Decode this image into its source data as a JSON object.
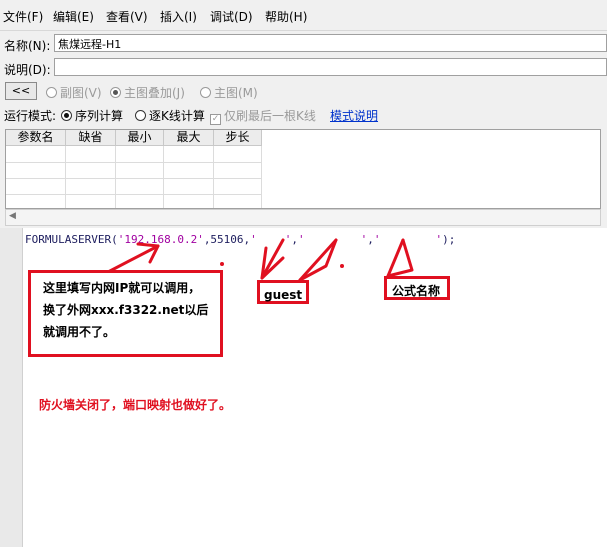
{
  "menu": [
    {
      "label": "文件(F)"
    },
    {
      "label": "编辑(E)"
    },
    {
      "label": "查看(V)"
    },
    {
      "label": "插入(I)"
    },
    {
      "label": "调试(D)"
    },
    {
      "label": "帮助(H)"
    }
  ],
  "form": {
    "name_label": "名称(N):",
    "name_value": "焦煤远程-H1",
    "desc_label": "说明(D):",
    "desc_value": "",
    "back_button": "<<",
    "view_options": [
      "副图(V)",
      "主图叠加(J)",
      "主图(M)"
    ],
    "view_selected": "主图叠加(J)"
  },
  "run_mode": {
    "label": "运行模式:",
    "options": [
      "序列计算",
      "逐K线计算"
    ],
    "selected": "序列计算",
    "checkbox_label": "仅刷最后一根K线",
    "checkbox_checked": true,
    "link": "模式说明"
  },
  "param_table": {
    "columns": [
      "参数名",
      "缺省",
      "最小",
      "最大",
      "步长"
    ]
  },
  "code": {
    "func": "FORMULASERVER(",
    "ip": "'192.168.0.2'",
    "port_part": ",55106,",
    "q1": "'",
    "q2": "'",
    "q3": "'",
    "q4": "'",
    "q5": "'",
    "q6": "'",
    "sep1": ",",
    "sep2": ",",
    "tail": ");"
  },
  "annotations": {
    "ip_note_line1": "这里填写内网IP就可以调用，",
    "ip_note_line2": "换了外网xxx.f3322.net以后",
    "ip_note_line3": "就调用不了。",
    "guest": "guest",
    "formula_name": "公式名称",
    "firewall_note": "防火墙关闭了，端口映射也做好了。"
  },
  "colors": {
    "annotation_red": "#e01020",
    "string_magenta": "#a000a0",
    "link_blue": "#0033cc"
  }
}
